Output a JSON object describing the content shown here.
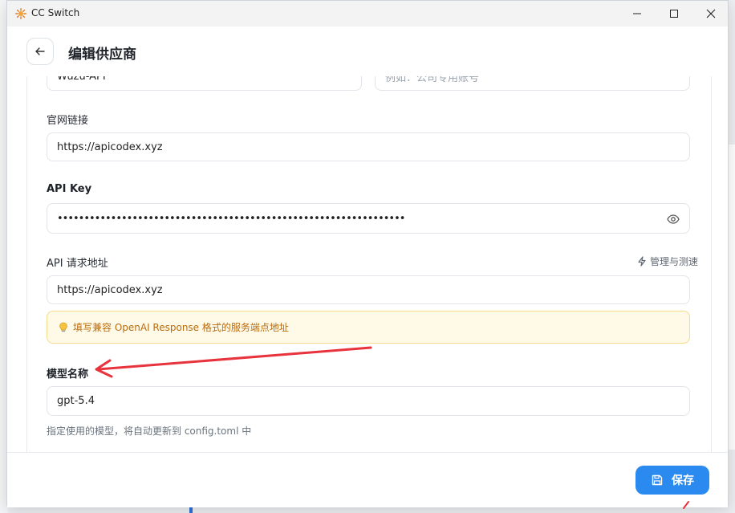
{
  "window": {
    "title": "CC Switch"
  },
  "header": {
    "title": "编辑供应商"
  },
  "form": {
    "name_value": "Wuzu-API",
    "note_placeholder": "例如：公司专用账号",
    "website_label": "官网链接",
    "website_value": "https://apicodex.xyz",
    "apikey_label": "API Key",
    "apikey_value": "•••••••••••••••••••••••••••••••••••••••••••••••••••••••••••••••••",
    "endpoint_label": "API 请求地址",
    "endpoint_manage": "管理与测速",
    "endpoint_value": "https://apicodex.xyz",
    "endpoint_hint": "填写兼容 OpenAI Response 格式的服务端点地址",
    "model_label": "模型名称",
    "model_value": "gpt-5.4",
    "model_helper": "指定使用的模型，将自动更新到 config.toml 中"
  },
  "footer": {
    "save_label": "保存"
  },
  "colors": {
    "accent": "#2b8af0",
    "hint_bg": "#fffae8",
    "hint_text": "#b86c0e",
    "arrow": "#e8333d"
  }
}
